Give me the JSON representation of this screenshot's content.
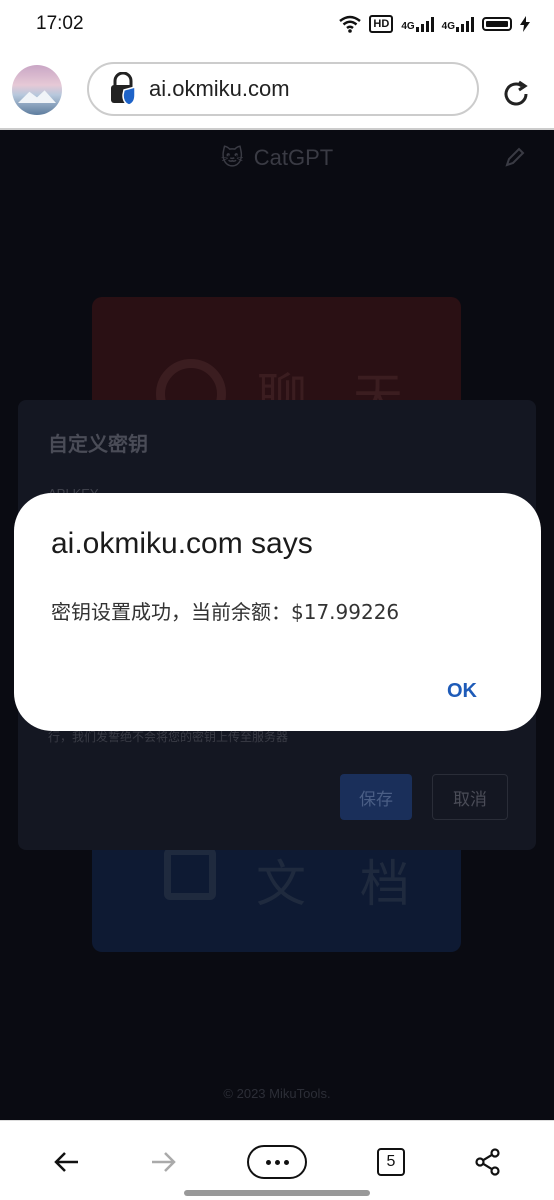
{
  "status_bar": {
    "time": "17:02",
    "hd_badge": "HD",
    "net_1": "4G",
    "net_2": "4G"
  },
  "browser": {
    "url": "ai.okmiku.com",
    "tab_count": "5"
  },
  "site": {
    "header_title": "CatGPT",
    "chat_card_label": "聊 天",
    "doc_card_label": "文 档",
    "footer": "© 2023 MikuTools."
  },
  "key_dialog": {
    "title": "自定义密钥",
    "api_key_label": "API KEY",
    "note": "行，我们发誓绝不会将您的密钥上传至服务器",
    "save_label": "保存",
    "cancel_label": "取消"
  },
  "alert": {
    "title": "ai.okmiku.com says",
    "message": "密钥设置成功，当前余额：$17.99226",
    "ok_label": "OK"
  },
  "icons": [
    "wifi-icon",
    "signal-icon",
    "battery-icon",
    "lock-icon",
    "reload-icon",
    "cat-icon",
    "edit-icon",
    "back-icon",
    "forward-icon",
    "more-icon",
    "tabs-icon",
    "share-icon"
  ],
  "colors": {
    "accent": "#1e5bb8",
    "overlay": "#000000",
    "alert_bg": "#ffffff"
  }
}
